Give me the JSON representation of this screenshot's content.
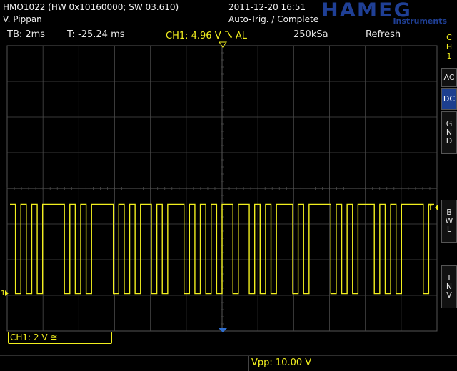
{
  "header": {
    "model": "HMO1022 (HW 0x10160000; SW 03.610)",
    "user": "V. Pippan",
    "datetime": "2011-12-20 16:51",
    "mode": "Auto-Trig. / Complete",
    "brand": "HAMEG",
    "brand_sub": "Instruments"
  },
  "status": {
    "timebase": "TB: 2ms",
    "trigger_time": "T: -25.24 ms",
    "ch1_trigger": "CH1: 4.96 V",
    "ch1_trigger_coupling": "AL",
    "sample_rate": "250kSa",
    "acq_mode": "Refresh"
  },
  "side_menu": {
    "channel": [
      "C",
      "H",
      "1"
    ],
    "ac": "AC",
    "dc": "DC",
    "gnd": [
      "G",
      "N",
      "D"
    ],
    "bwl": [
      "B",
      "W",
      "L"
    ],
    "inv": [
      "I",
      "N",
      "V"
    ]
  },
  "footer": {
    "ch1_vdiv": "CH1: 2 V ≅",
    "vpp": "Vpp: 10.00 V"
  },
  "colors": {
    "trace": "#f2ef1e",
    "grid": "#4a4a4a",
    "accent": "#1d3f8f",
    "background": "#000000"
  },
  "markers": {
    "channel_ground": "1",
    "trigger_level": "T"
  },
  "signal": {
    "high_level_v": 5.0,
    "low_level_v": 0.0,
    "bits": [
      1,
      0,
      1,
      0,
      1,
      0,
      1,
      1,
      1,
      1,
      0,
      1,
      0,
      1,
      0,
      1,
      1,
      1,
      1,
      0,
      1,
      0,
      1,
      0,
      1,
      1,
      0,
      1,
      0,
      1,
      1,
      1,
      0,
      1,
      0,
      1,
      0,
      1,
      0,
      1,
      1,
      0,
      1,
      1,
      0,
      1,
      0,
      1,
      0,
      1,
      1,
      1,
      0,
      1,
      0,
      1,
      1,
      1,
      1,
      0,
      1,
      0,
      1,
      0,
      1,
      1,
      1,
      0,
      1,
      0,
      1,
      0,
      1,
      1,
      1,
      1,
      0,
      1
    ]
  }
}
